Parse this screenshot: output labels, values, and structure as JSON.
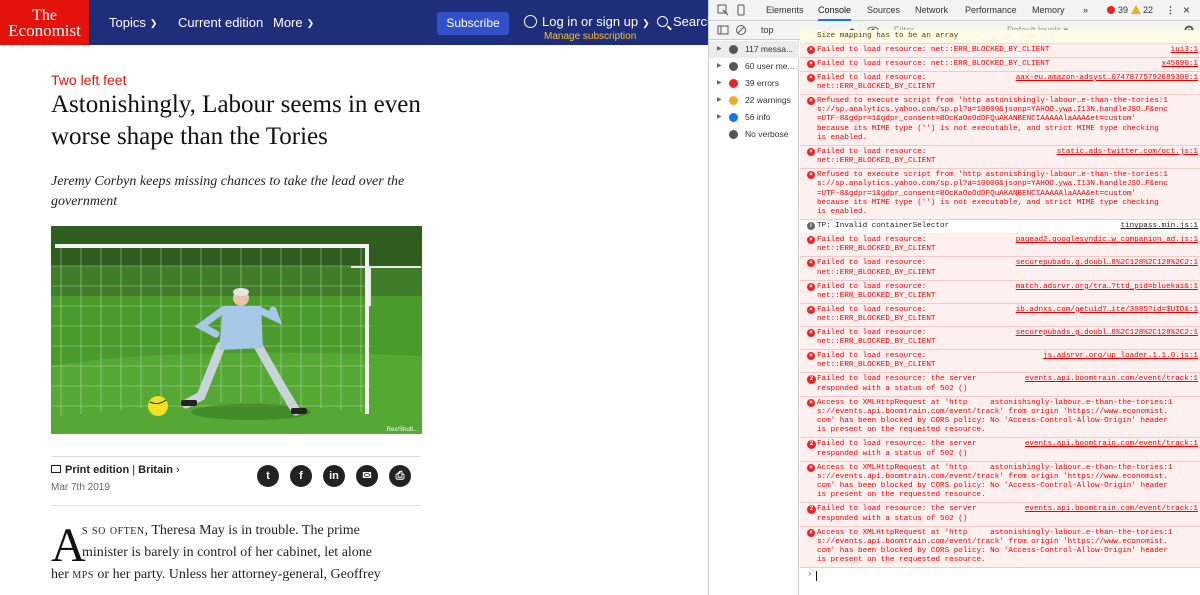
{
  "site": {
    "logo": [
      "The",
      "Economist"
    ],
    "nav": [
      {
        "label": "Topics",
        "chevron": true
      },
      {
        "label": "Current edition",
        "chevron": false
      },
      {
        "label": "More",
        "chevron": true
      }
    ],
    "subscribe_label": "Subscribe",
    "login_label": "Log in or sign up",
    "manage_label": "Manage subscription",
    "search_label": "Search",
    "article": {
      "kicker": "Two left feet",
      "headline": "Astonishingly, Labour seems in even worse shape than the Tories",
      "standfirst": "Jeremy Corbyn keeps missing chances to take the lead over the government",
      "photo_credit": "Rex/Shutt...",
      "edition": "Print edition",
      "section": "Britain",
      "date": "Mar 7th 2019",
      "share_icons": [
        "twitter-icon",
        "facebook-icon",
        "linkedin-icon",
        "email-icon",
        "print-icon"
      ],
      "dropcap": "A",
      "body_lines": [
        {
          "caps": "s so often",
          "text": ", Theresa May is in trouble. The prime"
        },
        {
          "caps": "",
          "text": "minister is barely in control of her cabinet, let alone"
        },
        {
          "caps": "",
          "text": "her ",
          "caps2": "mps",
          "text2": " or her party. Unless her attorney-general, Geoffrey"
        }
      ]
    }
  },
  "devtools": {
    "tabs": [
      "Elements",
      "Console",
      "Sources",
      "Network",
      "Performance",
      "Memory"
    ],
    "active_tab": "Console",
    "more_tabs": "»",
    "error_count": "39",
    "warning_count": "22",
    "context": "top",
    "filter_placeholder": "Filter",
    "levels": "Default levels ▾",
    "sidebar": [
      {
        "label": "117 messa...",
        "icon": "list-icon",
        "color": "#555"
      },
      {
        "label": "60 user me...",
        "icon": "user-icon",
        "color": "#555"
      },
      {
        "label": "39 errors",
        "icon": "error-icon",
        "color": "#e22"
      },
      {
        "label": "22 warnings",
        "icon": "warning-icon",
        "color": "#f2ab26"
      },
      {
        "label": "56 info",
        "icon": "info-icon",
        "color": "#1a73e8"
      },
      {
        "label": "No verbose",
        "icon": "bug-icon",
        "color": "#555"
      }
    ],
    "messages": [
      {
        "type": "warn",
        "lines": [
          "Size mapping has to be an array"
        ],
        "src": ""
      },
      {
        "type": "err",
        "lines": [
          "Failed to load resource: net::ERR_BLOCKED_BY_CLIENT"
        ],
        "src": "iui3:1"
      },
      {
        "type": "err",
        "lines": [
          "Failed to load resource: net::ERR_BLOCKED_BY_CLIENT"
        ],
        "src": "x45690:1"
      },
      {
        "type": "err",
        "lines": [
          "Failed to load resource:",
          "net::ERR_BLOCKED_BY_CLIENT"
        ],
        "src": "aax-eu.amazon-adsyst…07478775792689300:1"
      },
      {
        "type": "err",
        "lines": [
          "Refused to execute script from 'http astonishingly-labour…e-than-the-tories:1",
          "s://sp.analytics.yahoo.com/sp.pl?a=10000&jsonp=YAHOO.ywa.I13N.handleJSO…F&enc",
          "=UTF-8&gdpr=1&gdpr_consent=BOcKaOoOdDFQuAKANBENCIAAAAAlaAAA&et=custom'",
          "because its MIME type ('') is not executable, and strict MIME type checking",
          "is enabled."
        ],
        "src": ""
      },
      {
        "type": "err",
        "lines": [
          "Failed to load resource:",
          "net::ERR_BLOCKED_BY_CLIENT"
        ],
        "src": "static.ads-twitter.com/oct.js:1"
      },
      {
        "type": "err",
        "lines": [
          "Refused to execute script from 'http astonishingly-labour…e-than-the-tories:1",
          "s://sp.analytics.yahoo.com/sp.pl?a=10000&jsonp=YAHOO.ywa.I13N.handleJSO…F&enc",
          "=UTF-8&gdpr=1&gdpr_consent=BOcKaOoOdDFQuAKANBENCIAAAAAlaAAA&et=custom'",
          "because its MIME type ('') is not executable, and strict MIME type checking",
          "is enabled."
        ],
        "src": ""
      },
      {
        "type": "info",
        "lines": [
          "TP: Invalid containerSelector"
        ],
        "src": "tinypass.min.js:1"
      },
      {
        "type": "err",
        "lines": [
          "Failed to load resource:",
          "net::ERR_BLOCKED_BY_CLIENT"
        ],
        "src": "pagead2.googlesyndic…w_companion_ad.js:1"
      },
      {
        "type": "err",
        "lines": [
          "Failed to load resource:",
          "net::ERR_BLOCKED_BY_CLIENT"
        ],
        "src": "securepubads.g.doubl…8%2C128%2C128%2C2:1"
      },
      {
        "type": "err",
        "lines": [
          "Failed to load resource:",
          "net::ERR_BLOCKED_BY_CLIENT"
        ],
        "src": "match.adsrvr.org/tra…?ttd_pid=bluekai&:1"
      },
      {
        "type": "err",
        "lines": [
          "Failed to load resource:",
          "net::ERR_BLOCKED_BY_CLIENT"
        ],
        "src": "ib.adnxs.com/getuid?…ite/3085?id=$UID&:1"
      },
      {
        "type": "err",
        "lines": [
          "Failed to load resource:",
          "net::ERR_BLOCKED_BY_CLIENT"
        ],
        "src": "securepubads.g.doubl…8%2C128%2C128%2C2:1"
      },
      {
        "type": "err",
        "lines": [
          "Failed to load resource:",
          "net::ERR_BLOCKED_BY_CLIENT"
        ],
        "src": "js.adsrvr.org/up_loader.1.1.0.js:1"
      },
      {
        "type": "err",
        "count": "2",
        "lines": [
          "Failed to load resource: the server",
          "responded with a status of 502 ()"
        ],
        "src": "events.api.boomtrain.com/event/track:1"
      },
      {
        "type": "err",
        "lines": [
          "Access to XMLHttpRequest at 'http     astonishingly-labour…e-than-the-tories:1",
          "s://events.api.boomtrain.com/event/track' from origin 'https://www.economist.",
          "com' has been blocked by CORS policy: No 'Access-Control-Allow-Origin' header",
          "is present on the requested resource."
        ],
        "src": ""
      },
      {
        "type": "err",
        "count": "2",
        "lines": [
          "Failed to load resource: the server",
          "responded with a status of 502 ()"
        ],
        "src": "events.api.boomtrain.com/event/track:1"
      },
      {
        "type": "err",
        "lines": [
          "Access to XMLHttpRequest at 'http     astonishingly-labour…e-than-the-tories:1",
          "s://events.api.boomtrain.com/event/track' from origin 'https://www.economist.",
          "com' has been blocked by CORS policy: No 'Access-Control-Allow-Origin' header",
          "is present on the requested resource."
        ],
        "src": ""
      },
      {
        "type": "err",
        "count": "2",
        "lines": [
          "Failed to load resource: the server",
          "responded with a status of 502 ()"
        ],
        "src": "events.api.boomtrain.com/event/track:1"
      },
      {
        "type": "err",
        "lines": [
          "Access to XMLHttpRequest at 'http     astonishingly-labour…e-than-the-tories:1",
          "s://events.api.boomtrain.com/event/track' from origin 'https://www.economist.",
          "com' has been blocked by CORS policy: No 'Access-Control-Allow-Origin' header",
          "is present on the requested resource."
        ],
        "src": ""
      }
    ],
    "prompt": "›"
  }
}
